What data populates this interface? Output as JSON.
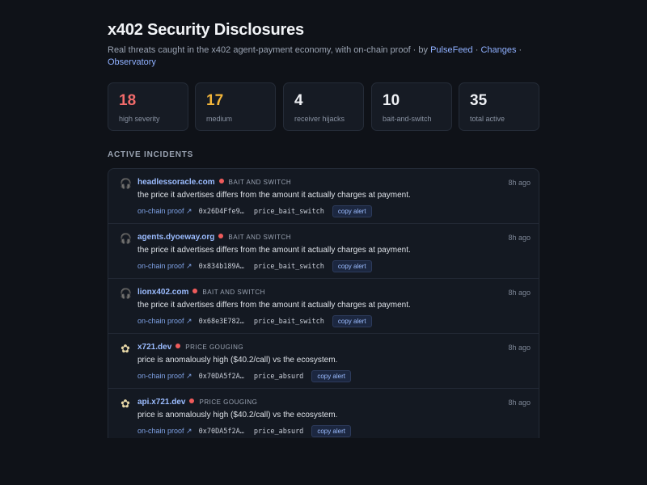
{
  "header": {
    "title": "x402 Security Disclosures",
    "subtitle": "Real threats caught in the x402 agent-payment economy, with on-chain proof · by ",
    "by_link": "PulseFeed",
    "sep": " · ",
    "changes_link": "Changes",
    "sep2": " · ",
    "observatory_link": "Observatory"
  },
  "stats": [
    {
      "value": "18",
      "label": "high severity",
      "color": "#f26b6b"
    },
    {
      "value": "17",
      "label": "medium",
      "color": "#f2b53a"
    },
    {
      "value": "4",
      "label": "receiver hijacks",
      "color": "#eef0f4"
    },
    {
      "value": "10",
      "label": "bait-and-switch",
      "color": "#eef0f4"
    },
    {
      "value": "35",
      "label": "total active",
      "color": "#eef0f4"
    }
  ],
  "section_title": "ACTIVE INCIDENTS",
  "incidents": [
    {
      "icon": "oracle-icon",
      "domain": "headlessoracle.com",
      "tag": "BAIT AND SWITCH",
      "time": "8h ago",
      "desc": "the price it advertises differs from the amount it actually charges at payment.",
      "proof": "on-chain proof ↗",
      "hash": "0x26D4Ffe9…",
      "code": "price_bait_switch",
      "button": "copy alert"
    },
    {
      "icon": "oracle-icon",
      "domain": "agents.dyoeway.org",
      "tag": "BAIT AND SWITCH",
      "time": "8h ago",
      "desc": "the price it advertises differs from the amount it actually charges at payment.",
      "proof": "on-chain proof ↗",
      "hash": "0x834b189A…",
      "code": "price_bait_switch",
      "button": "copy alert"
    },
    {
      "icon": "oracle-icon",
      "domain": "lionx402.com",
      "tag": "BAIT AND SWITCH",
      "time": "8h ago",
      "desc": "the price it advertises differs from the amount it actually charges at payment.",
      "proof": "on-chain proof ↗",
      "hash": "0x68e3E782…",
      "code": "price_bait_switch",
      "button": "copy alert"
    },
    {
      "icon": "flower-icon",
      "domain": "x721.dev",
      "tag": "PRICE GOUGING",
      "time": "8h ago",
      "desc": "price is anomalously high ($40.2/call) vs the ecosystem.",
      "proof": "on-chain proof ↗",
      "hash": "0x70DA5f2A…",
      "code": "price_absurd",
      "button": "copy alert"
    },
    {
      "icon": "flower-icon",
      "domain": "api.x721.dev",
      "tag": "PRICE GOUGING",
      "time": "8h ago",
      "desc": "price is anomalously high ($40.2/call) vs the ecosystem.",
      "proof": "on-chain proof ↗",
      "hash": "0x70DA5f2A…",
      "code": "price_absurd",
      "button": "copy alert"
    }
  ]
}
